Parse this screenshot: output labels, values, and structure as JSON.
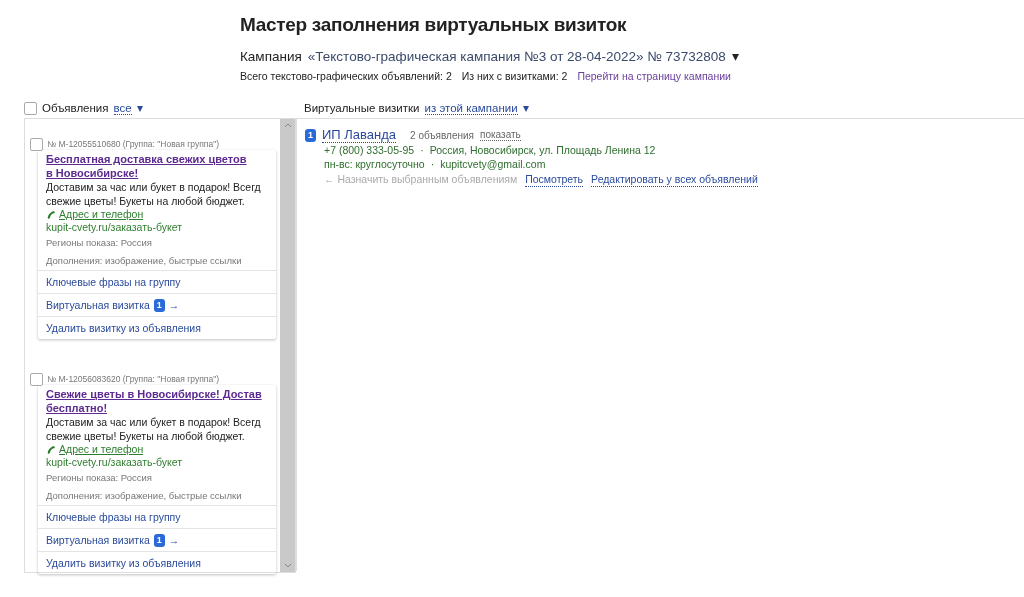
{
  "title": "Мастер заполнения виртуальных визиток",
  "campaign": {
    "label": "Кампания",
    "name": "«Текстово-графическая кампания №3 от 28-04-2022» № 73732808",
    "caret": "▾"
  },
  "stats": [
    {
      "kind": "text",
      "text": "Всего текстово-графических объявлений: 2"
    },
    {
      "kind": "text",
      "text": "Из них с визитками: 2"
    },
    {
      "kind": "link",
      "text": "Перейти на страницу кампании"
    }
  ],
  "ads_header": {
    "checked": false,
    "label": "Объявления",
    "filter": "все",
    "caret": "▾"
  },
  "ads": [
    {
      "checked": false,
      "meta": "№ M-12055510680 (Группа: \"Новая группа\")",
      "title_lines": [
        "Бесплатная доставка свежих цветов",
        "в Новосибирске!"
      ],
      "body_lines": [
        "Доставим за час или букет в подарок! Всегд",
        "свежие цветы! Букеты на любой бюджет."
      ],
      "contact_link": "Адрес и телефон",
      "url": "kupit-cvety.ru/заказать-букет",
      "regions": "Регионы показа: Россия",
      "extras": "Дополнения: изображение, быстрые ссылки",
      "actions": [
        {
          "kind": "link",
          "text": "Ключевые фразы на группу"
        },
        {
          "kind": "card",
          "text": "Виртуальная визитка",
          "badge": "1",
          "arrow": "→"
        },
        {
          "kind": "link",
          "text": "Удалить визитку из объявления"
        }
      ]
    },
    {
      "checked": false,
      "meta": "№ M-12056083620 (Группа: \"Новая группа\")",
      "title_lines": [
        "Свежие цветы в Новосибирске! Достав",
        "бесплатно!"
      ],
      "body_lines": [
        "Доставим за час или букет в подарок! Всегд",
        "свежие цветы! Букеты на любой бюджет."
      ],
      "contact_link": "Адрес и телефон",
      "url": "kupit-cvety.ru/заказать-букет",
      "regions": "Регионы показа: Россия",
      "extras": "Дополнения: изображение, быстрые ссылки",
      "actions": [
        {
          "kind": "link",
          "text": "Ключевые фразы на группу"
        },
        {
          "kind": "card",
          "text": "Виртуальная визитка",
          "badge": "1",
          "arrow": "→"
        },
        {
          "kind": "link",
          "text": "Удалить визитку из объявления"
        }
      ]
    }
  ],
  "cards_header": {
    "label": "Виртуальные визитки",
    "filter": "из этой кампании",
    "caret": "▾"
  },
  "cards": [
    {
      "badge": "1",
      "name": "ИП Лаванда",
      "count": "2 объявления",
      "show": "показать",
      "lines": [
        [
          "+7 (800) 333-05-95",
          "Россия, Новосибирск, ул. Площадь Ленина 12"
        ],
        [
          "пн-вс: круглосуточно",
          "kupitcvety@gmail.com"
        ]
      ],
      "separator": "·",
      "assign": "← Назначить выбранным объявлениям",
      "actions": [
        "Посмотреть",
        "Редактировать у всех объявлений"
      ]
    }
  ]
}
